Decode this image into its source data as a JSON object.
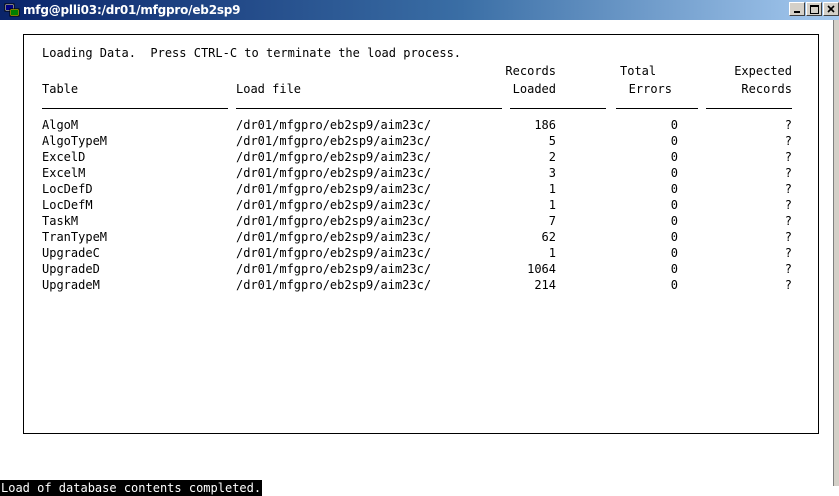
{
  "window": {
    "title": "mfg@plli03:/dr01/mfgpro/eb2sp9"
  },
  "header": {
    "message": "Loading Data.  Press CTRL-C to terminate the load process.",
    "col_table": "Table",
    "col_file": "Load file",
    "col_records_l1": "Records",
    "col_records_l2": "Loaded",
    "col_errors_l1": "Total",
    "col_errors_l2": "Errors",
    "col_expected_l1": "Expected",
    "col_expected_l2": "Records"
  },
  "rows": [
    {
      "table": "AlgoM",
      "file": "/dr01/mfgpro/eb2sp9/aim23c/",
      "loaded": "186",
      "errors": "0",
      "expected": "?"
    },
    {
      "table": "AlgoTypeM",
      "file": "/dr01/mfgpro/eb2sp9/aim23c/",
      "loaded": "5",
      "errors": "0",
      "expected": "?"
    },
    {
      "table": "ExcelD",
      "file": "/dr01/mfgpro/eb2sp9/aim23c/",
      "loaded": "2",
      "errors": "0",
      "expected": "?"
    },
    {
      "table": "ExcelM",
      "file": "/dr01/mfgpro/eb2sp9/aim23c/",
      "loaded": "3",
      "errors": "0",
      "expected": "?"
    },
    {
      "table": "LocDefD",
      "file": "/dr01/mfgpro/eb2sp9/aim23c/",
      "loaded": "1",
      "errors": "0",
      "expected": "?"
    },
    {
      "table": "LocDefM",
      "file": "/dr01/mfgpro/eb2sp9/aim23c/",
      "loaded": "1",
      "errors": "0",
      "expected": "?"
    },
    {
      "table": "TaskM",
      "file": "/dr01/mfgpro/eb2sp9/aim23c/",
      "loaded": "7",
      "errors": "0",
      "expected": "?"
    },
    {
      "table": "TranTypeM",
      "file": "/dr01/mfgpro/eb2sp9/aim23c/",
      "loaded": "62",
      "errors": "0",
      "expected": "?"
    },
    {
      "table": "UpgradeC",
      "file": "/dr01/mfgpro/eb2sp9/aim23c/",
      "loaded": "1",
      "errors": "0",
      "expected": "?"
    },
    {
      "table": "UpgradeD",
      "file": "/dr01/mfgpro/eb2sp9/aim23c/",
      "loaded": "1064",
      "errors": "0",
      "expected": "?"
    },
    {
      "table": "UpgradeM",
      "file": "/dr01/mfgpro/eb2sp9/aim23c/",
      "loaded": "214",
      "errors": "0",
      "expected": "?"
    }
  ],
  "status": {
    "message": "Load of database contents completed."
  },
  "icons": {
    "app": "terminal-app-icon",
    "minimize": "minimize-icon",
    "maximize": "maximize-icon",
    "close": "close-icon"
  },
  "colors": {
    "titlebar_start": "#0a246a",
    "titlebar_end": "#a6caf0",
    "status_bg": "#000000",
    "status_fg": "#ffffff"
  }
}
